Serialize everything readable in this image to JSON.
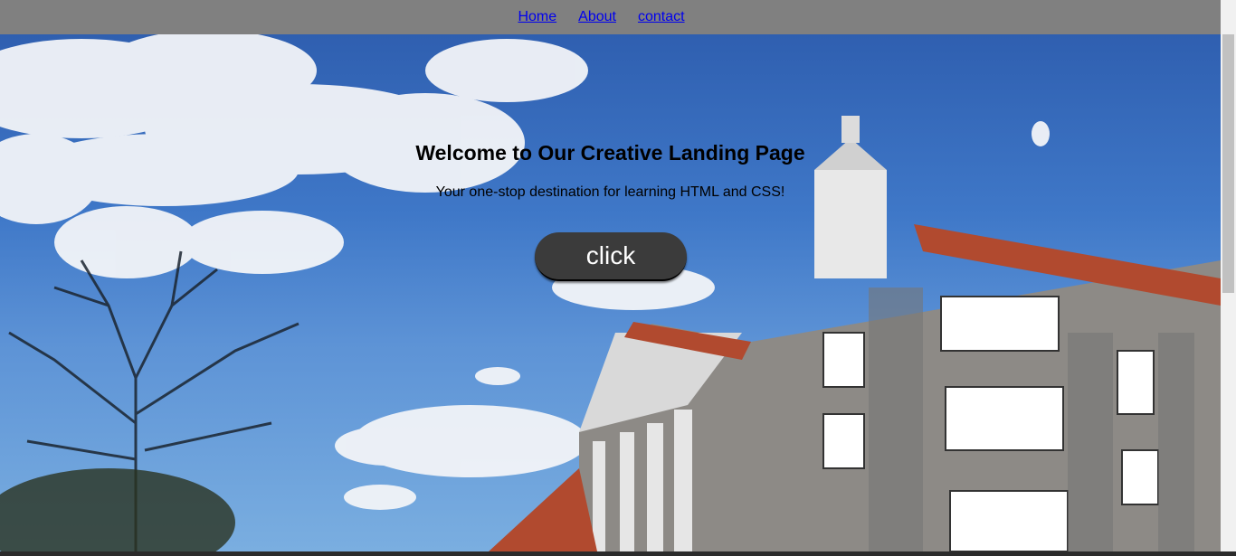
{
  "nav": {
    "links": [
      {
        "label": "Home"
      },
      {
        "label": "About"
      },
      {
        "label": "contact"
      }
    ]
  },
  "hero": {
    "title": "Welcome to Our Creative Landing Page",
    "subtitle": "Your one-stop destination for learning HTML and CSS!",
    "button_label": "click"
  },
  "colors": {
    "navbar_bg": "#808080",
    "link": "#0000ee",
    "button_bg": "#3b3b3b",
    "button_text": "#ffffff"
  }
}
